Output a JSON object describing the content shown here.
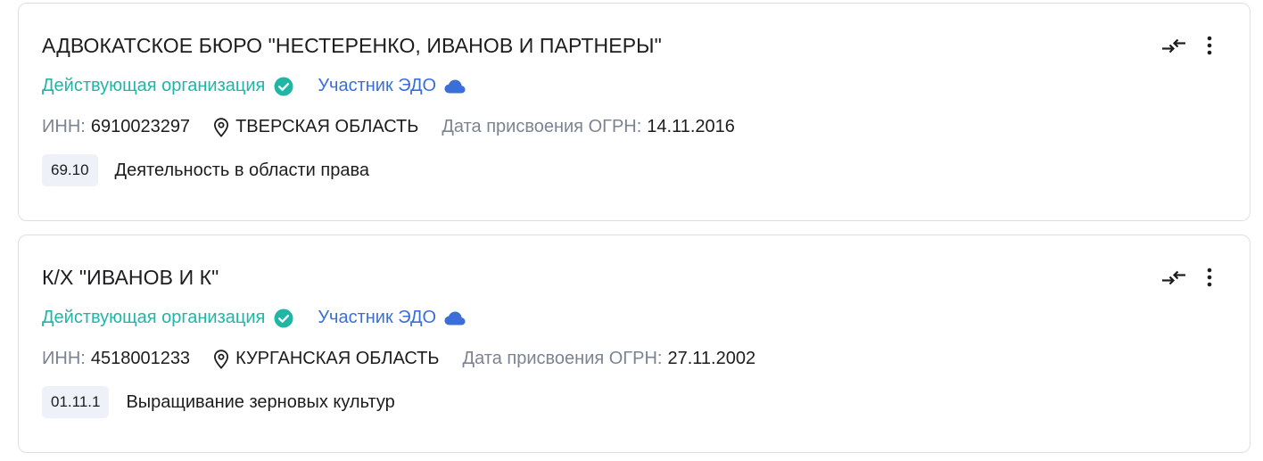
{
  "organizations": [
    {
      "title": "АДВОКАТСКОЕ БЮРО \"НЕСТЕРЕНКО, ИВАНОВ И ПАРТНЕРЫ\"",
      "status": "Действующая организация",
      "edo": "Участник ЭДО",
      "inn_label": "ИНН:",
      "inn": "6910023297",
      "region": "ТВЕРСКАЯ ОБЛАСТЬ",
      "ogrn_label": "Дата присвоения ОГРН:",
      "ogrn_date": "14.11.2016",
      "okved_code": "69.10",
      "okved_text": "Деятельность в области права"
    },
    {
      "title": "К/Х \"ИВАНОВ И К\"",
      "status": "Действующая организация",
      "edo": "Участник ЭДО",
      "inn_label": "ИНН:",
      "inn": "4518001233",
      "region": "КУРГАНСКАЯ ОБЛАСТЬ",
      "ogrn_label": "Дата присвоения ОГРН:",
      "ogrn_date": "27.11.2002",
      "okved_code": "01.11.1",
      "okved_text": "Выращивание зерновых культур"
    }
  ],
  "icons": {
    "status": "check-circle-icon",
    "edo": "cloud-icon",
    "region": "map-pin-icon",
    "compare": "compare-arrows-icon",
    "menu": "more-vertical-icon"
  },
  "colors": {
    "status_active": "#21b5a5",
    "edo": "#3a6fd8",
    "muted": "#7c8391",
    "text": "#1d1d1f",
    "badge_bg": "#eef1f7",
    "border": "#dcdfe4"
  }
}
